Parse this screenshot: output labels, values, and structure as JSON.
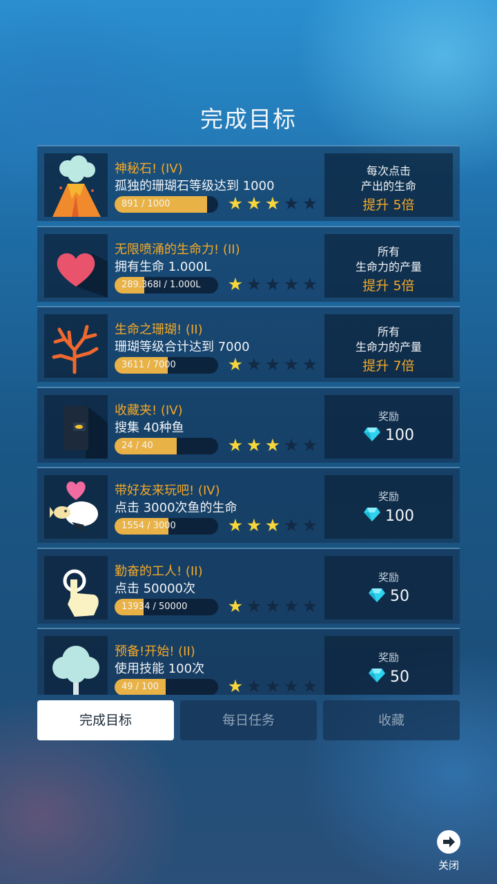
{
  "header": {
    "title": "完成目标"
  },
  "achievements": [
    {
      "title": "神秘石! (IV)",
      "desc": "孤独的珊瑚石等级达到 1000",
      "progress_text": "891 / 1000",
      "progress": 0.891,
      "stars": 3,
      "icon": "volcano-icon",
      "reward": {
        "type": "boost",
        "line1": "每次点击",
        "line2": "产出的生命",
        "boost": "提升 5倍"
      }
    },
    {
      "title": "无限喷涌的生命力! (II)",
      "desc": "拥有生命 1.000L",
      "progress_text": "289.368l / 1.000L",
      "progress": 0.289,
      "stars": 1,
      "icon": "heart-icon",
      "reward": {
        "type": "boost",
        "line1": "所有",
        "line2": "生命力的产量",
        "boost": "提升 5倍"
      }
    },
    {
      "title": "生命之珊瑚! (II)",
      "desc": "珊瑚等级合计达到 7000",
      "progress_text": "3611 / 7000",
      "progress": 0.516,
      "stars": 1,
      "icon": "coral-icon",
      "reward": {
        "type": "boost",
        "line1": "所有",
        "line2": "生命力的产量",
        "boost": "提升 7倍"
      }
    },
    {
      "title": "收藏夹! (IV)",
      "desc": "搜集 40种鱼",
      "progress_text": "24 / 40",
      "progress": 0.6,
      "stars": 3,
      "icon": "fish-book-icon",
      "reward": {
        "type": "gem",
        "label": "奖励",
        "amount": "100"
      }
    },
    {
      "title": "带好友来玩吧! (IV)",
      "desc": "点击 3000次鱼的生命",
      "progress_text": "1554 / 3000",
      "progress": 0.518,
      "stars": 3,
      "icon": "friends-fish-icon",
      "reward": {
        "type": "gem",
        "label": "奖励",
        "amount": "100"
      }
    },
    {
      "title": "勤奋的工人! (II)",
      "desc": "点击 50000次",
      "progress_text": "13934 / 50000",
      "progress": 0.279,
      "stars": 1,
      "icon": "tap-hand-icon",
      "reward": {
        "type": "gem",
        "label": "奖励",
        "amount": "50"
      }
    },
    {
      "title": "预备!开始! (II)",
      "desc": "使用技能 100次",
      "progress_text": "49 / 100",
      "progress": 0.49,
      "stars": 1,
      "icon": "tree-icon",
      "reward": {
        "type": "gem",
        "label": "奖励",
        "amount": "50"
      }
    }
  ],
  "max_stars": 5,
  "tabs": [
    {
      "label": "完成目标",
      "active": true
    },
    {
      "label": "每日任务",
      "active": false
    },
    {
      "label": "收藏",
      "active": false
    }
  ],
  "close": {
    "label": "关闭"
  },
  "colors": {
    "accent_orange": "#f4a928",
    "star": "#f7d53b",
    "gem": "#2ed3ee",
    "bar": "#e9b247"
  }
}
